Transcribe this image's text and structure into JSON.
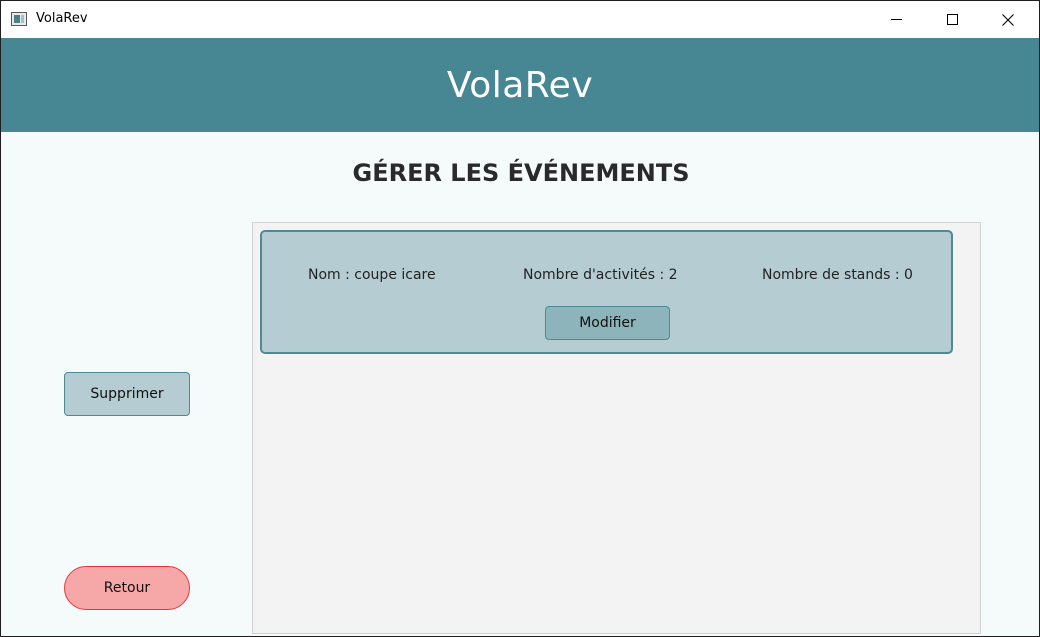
{
  "window": {
    "title": "VolaRev",
    "controls": {
      "minimize_icon": "minimize-icon",
      "maximize_icon": "maximize-icon",
      "close_icon": "close-icon"
    }
  },
  "header": {
    "title": "VolaRev"
  },
  "page": {
    "title": "GÉRER LES ÉVÉNEMENTS"
  },
  "actions": {
    "delete_label": "Supprimer",
    "back_label": "Retour"
  },
  "events": [
    {
      "name_text": "Nom : coupe icare",
      "activities_text": "Nombre d'activités : 2",
      "stands_text": "Nombre de stands : 0",
      "edit_label": "Modifier"
    }
  ],
  "colors": {
    "header_bg": "#478693",
    "page_bg": "#f4fbfa",
    "card_bg": "#b5cdd2",
    "card_border": "#4e8a96",
    "button_bg": "#8db4ba",
    "back_bg": "#f6a7a7",
    "back_border": "#e53939"
  }
}
